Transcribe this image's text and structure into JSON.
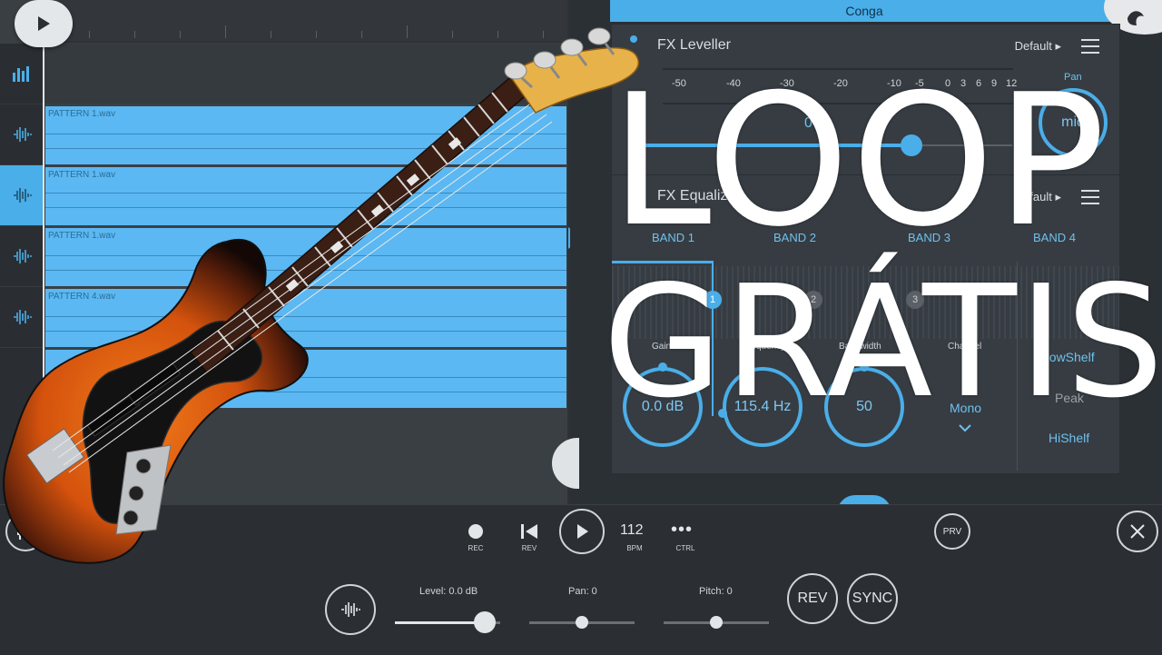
{
  "app": {
    "accent": "#4aaee8"
  },
  "tracks": [
    {
      "icon": "meter-icon"
    },
    {
      "icon": "waveform-icon"
    },
    {
      "icon": "waveform-icon",
      "active": true
    },
    {
      "icon": "waveform-icon"
    },
    {
      "icon": "waveform-icon"
    }
  ],
  "clips": [
    {
      "name": "PATTERN 1.wav"
    },
    {
      "name": "PATTERN 1.wav"
    },
    {
      "name": "PATTERN 1.wav"
    },
    {
      "name": "PATTERN 4.wav"
    },
    {
      "name": ""
    }
  ],
  "channel_name": "Conga",
  "fx_leveller": {
    "title": "FX Leveller",
    "preset": "Default",
    "scale": [
      "-50",
      "-40",
      "-30",
      "-20",
      "-10",
      "-5",
      "0",
      "3",
      "6",
      "9",
      "12"
    ],
    "pan_label": "Pan",
    "pan_value": "mid",
    "value_partial": "0"
  },
  "fx_equalizer": {
    "title": "FX Equalizer",
    "preset": "Default",
    "bands": [
      "BAND 1",
      "BAND 2",
      "BAND 3",
      "BAND 4"
    ],
    "band_numbers": [
      "1",
      "2",
      "3"
    ],
    "knobs": [
      {
        "label": "Gain",
        "value": "0.0 dB"
      },
      {
        "label": "Frequency",
        "value": "115.4 Hz"
      },
      {
        "label": "Bandwidth",
        "value": "50"
      }
    ],
    "channel_label": "Channel",
    "channel_value": "Mono",
    "filter_types": [
      "LowShelf",
      "Peak",
      "HiShelf"
    ]
  },
  "transport": {
    "rec": "REC",
    "rev": "REV",
    "bpm_value": "112",
    "bpm": "BPM",
    "ctrl": "CTRL",
    "prv": "PRV",
    "level_label": "Level: 0.0 dB",
    "level_value": 0.85,
    "pan_label": "Pan: 0",
    "pan_value": 0.5,
    "pitch_label": "Pitch: 0",
    "pitch_value": 0.5,
    "rev_button": "REV",
    "sync_button": "SYNC"
  },
  "overlay": {
    "line1": "LOOP",
    "line2": "GRÁTIS"
  }
}
